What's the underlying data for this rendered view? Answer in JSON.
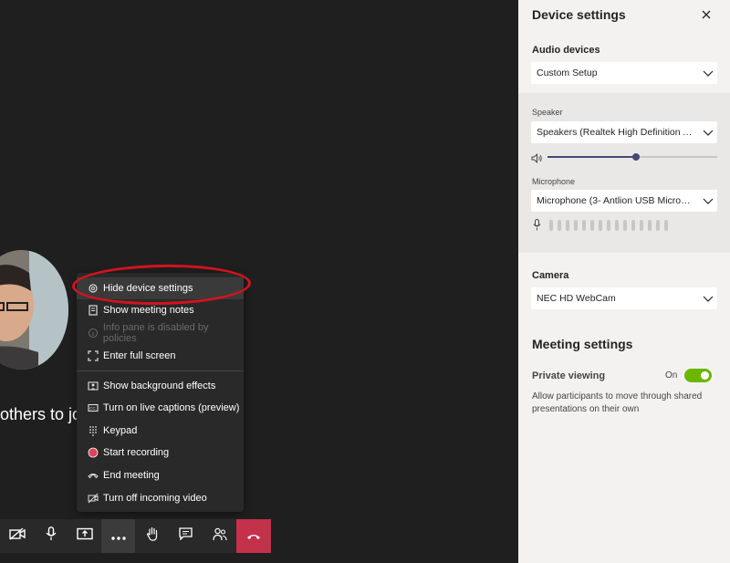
{
  "stage": {
    "invite_text": "others to jo"
  },
  "menu": {
    "items": [
      {
        "label": "Hide device settings",
        "icon": "gear-icon",
        "enabled": true
      },
      {
        "label": "Show meeting notes",
        "icon": "notes-icon",
        "enabled": true
      },
      {
        "label": "Info pane is disabled by policies",
        "icon": "info-icon",
        "enabled": false
      },
      {
        "label": "Enter full screen",
        "icon": "fullscreen-icon",
        "enabled": true
      },
      {
        "label": "Show background effects",
        "icon": "background-effects-icon",
        "enabled": true
      },
      {
        "label": "Turn on live captions (preview)",
        "icon": "captions-icon",
        "enabled": true
      },
      {
        "label": "Keypad",
        "icon": "keypad-icon",
        "enabled": true
      },
      {
        "label": "Start recording",
        "icon": "record-icon",
        "enabled": true
      },
      {
        "label": "End meeting",
        "icon": "end-meeting-icon",
        "enabled": true
      },
      {
        "label": "Turn off incoming video",
        "icon": "video-off-icon",
        "enabled": true
      }
    ]
  },
  "toolbar": {
    "buttons": [
      "camera-off-icon",
      "microphone-icon",
      "share-screen-icon",
      "more-options-icon",
      "raise-hand-icon",
      "chat-icon",
      "participants-icon",
      "hang-up-icon"
    ],
    "hangup_color": "#c4314b"
  },
  "panel": {
    "title": "Device settings",
    "audio_devices_label": "Audio devices",
    "audio_devices_value": "Custom Setup",
    "speaker_label": "Speaker",
    "speaker_value": "Speakers (Realtek High Definition Au...",
    "speaker_volume": 0.52,
    "microphone_label": "Microphone",
    "microphone_value": "Microphone (3- Antlion USB Microph...",
    "camera_label": "Camera",
    "camera_value": "NEC HD WebCam",
    "meeting_settings_title": "Meeting settings",
    "private_viewing_label": "Private viewing",
    "private_viewing_state": "On",
    "private_viewing_desc": "Allow participants to move through shared presentations on their own",
    "toggle_color": "#6bb700"
  }
}
